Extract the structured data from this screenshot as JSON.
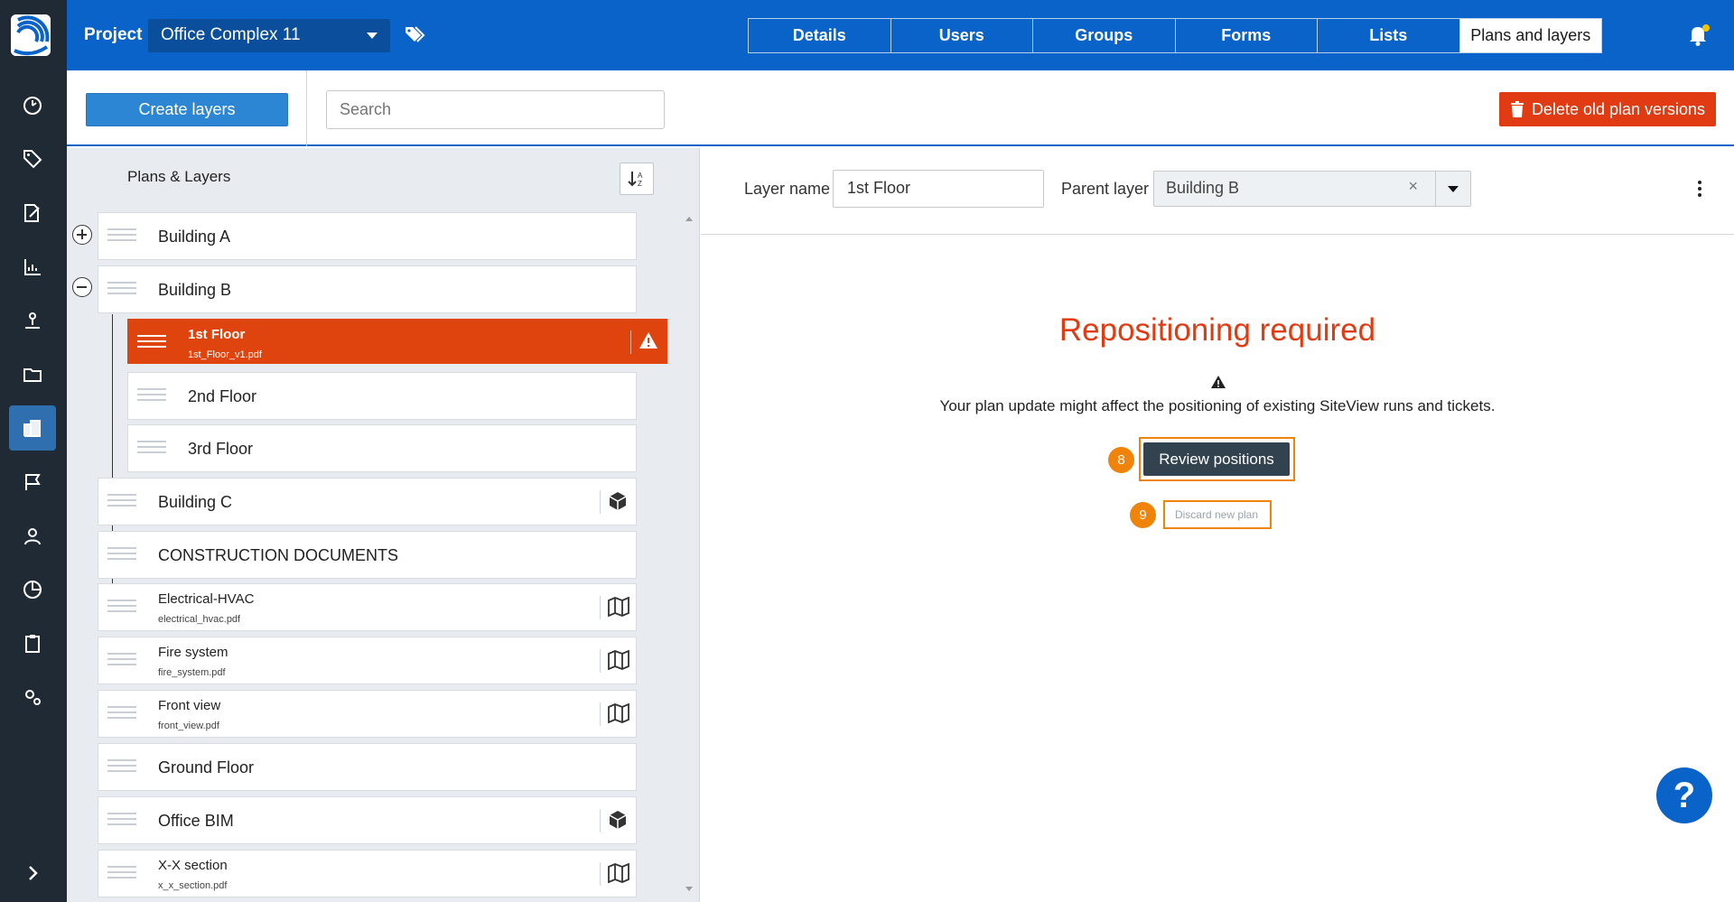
{
  "header": {
    "project_label": "Project",
    "project_name": "Office Complex 11",
    "tabs": [
      {
        "label": "Details"
      },
      {
        "label": "Users"
      },
      {
        "label": "Groups"
      },
      {
        "label": "Forms"
      },
      {
        "label": "Lists"
      },
      {
        "label": "Plans and layers",
        "active": true
      }
    ]
  },
  "toolbar": {
    "create_label": "Create layers",
    "search_placeholder": "Search",
    "delete_label": "Delete old plan versions"
  },
  "tree": {
    "title": "Plans & Layers",
    "items": [
      {
        "title": "Building A",
        "expander": "plus"
      },
      {
        "title": "Building B",
        "expander": "minus"
      },
      {
        "title": "1st Floor",
        "subtitle": "1st_Floor_v1.pdf",
        "selected": true,
        "icon": "warning-icon"
      },
      {
        "title": "2nd Floor"
      },
      {
        "title": "3rd Floor"
      },
      {
        "title": "Building C",
        "icon": "cube-icon"
      },
      {
        "title": "CONSTRUCTION DOCUMENTS"
      },
      {
        "title": "Electrical-HVAC",
        "subtitle": "electrical_hvac.pdf",
        "icon": "map-icon"
      },
      {
        "title": "Fire system",
        "subtitle": "fire_system.pdf",
        "icon": "map-icon"
      },
      {
        "title": "Front view",
        "subtitle": "front_view.pdf",
        "icon": "map-icon"
      },
      {
        "title": "Ground Floor"
      },
      {
        "title": "Office BIM",
        "icon": "cube-icon"
      },
      {
        "title": "X-X section",
        "subtitle": "x_x_section.pdf",
        "icon": "map-icon"
      }
    ]
  },
  "detail": {
    "layer_name_label": "Layer name",
    "layer_name_value": "1st Floor",
    "parent_layer_label": "Parent layer",
    "parent_layer_value": "Building B",
    "heading": "Repositioning required",
    "message": "Your plan update might affect the positioning of existing SiteView runs and tickets.",
    "review_label": "Review positions",
    "discard_label": "Discard new plan",
    "step_review": "8",
    "step_discard": "9"
  },
  "help_label": "?",
  "colors": {
    "brand_blue": "#0a63c8",
    "danger": "#e03b12",
    "selected_row": "#e0440e",
    "highlight": "#f0830a",
    "rail": "#1f2a35"
  }
}
